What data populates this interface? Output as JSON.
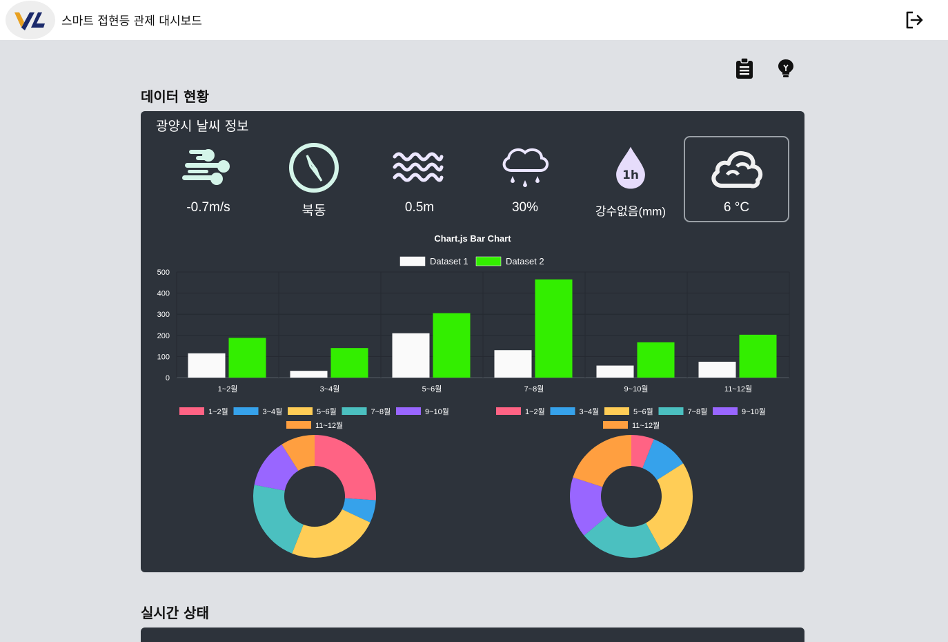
{
  "app": {
    "title": "스마트 접현등 관제 대시보드"
  },
  "sections": {
    "data_status": "데이터 현황",
    "realtime_status": "실시간 상태"
  },
  "weather": {
    "title": "광양시 날씨 정보",
    "items": [
      {
        "icon": "wind-icon",
        "value": "-0.7m/s"
      },
      {
        "icon": "compass-icon",
        "value": "북동"
      },
      {
        "icon": "waves-icon",
        "value": "0.5m"
      },
      {
        "icon": "rain-cloud-icon",
        "value": "30%"
      },
      {
        "icon": "raindrop-1h-icon",
        "value": "강수없음(mm)",
        "badge": "1h"
      },
      {
        "icon": "cloud-icon",
        "value": "6 °C",
        "selected": true
      }
    ]
  },
  "colors": {
    "panel_bg": "#2d333b",
    "page_bg": "#dfe1e5",
    "icon_mint": "#d4f5e9",
    "dataset1": "#ffffff",
    "dataset2": "#33ee00"
  },
  "chart_data": [
    {
      "type": "bar",
      "title": "Chart.js Bar Chart",
      "categories": [
        "1~2월",
        "3~4월",
        "5~6월",
        "7~8월",
        "9~10월",
        "11~12월"
      ],
      "series": [
        {
          "name": "Dataset 1",
          "values": [
            115,
            32,
            210,
            130,
            57,
            75
          ],
          "color": "#fafafa"
        },
        {
          "name": "Dataset 2",
          "values": [
            188,
            140,
            305,
            465,
            167,
            203
          ],
          "color": "#33ee00"
        }
      ],
      "ylim": [
        0,
        500
      ],
      "yticks": [
        0,
        100,
        200,
        300,
        400,
        500
      ],
      "legend": "top",
      "grid": true
    },
    {
      "type": "pie",
      "variant": "doughnut",
      "labels": [
        "1~2월",
        "3~4월",
        "5~6월",
        "7~8월",
        "9~10월",
        "11~12월"
      ],
      "values": [
        26,
        6,
        24,
        22,
        13,
        9
      ],
      "colors": [
        "#ff6384",
        "#36a2eb",
        "#ffcd56",
        "#4bc0c0",
        "#9966ff",
        "#ff9f40"
      ],
      "legend": "top"
    },
    {
      "type": "pie",
      "variant": "doughnut",
      "labels": [
        "1~2월",
        "3~4월",
        "5~6월",
        "7~8월",
        "9~10월",
        "11~12월"
      ],
      "values": [
        6,
        10,
        26,
        22,
        16,
        20
      ],
      "colors": [
        "#ff6384",
        "#36a2eb",
        "#ffcd56",
        "#4bc0c0",
        "#9966ff",
        "#ff9f40"
      ],
      "legend": "top"
    }
  ]
}
